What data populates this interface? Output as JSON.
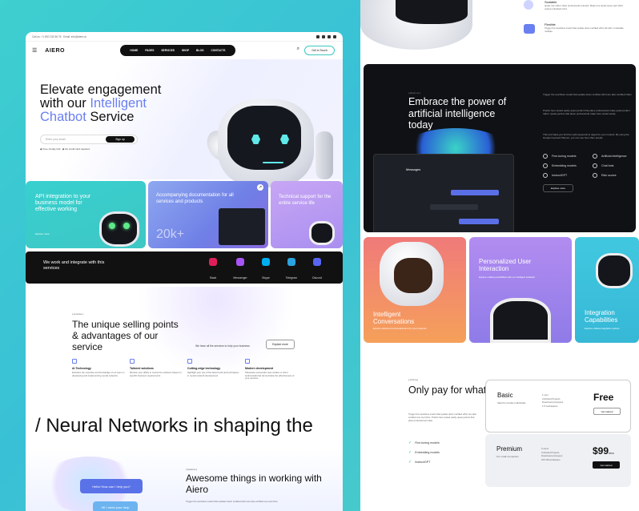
{
  "left": {
    "topbar": {
      "phone": "Call us: +1 800 234 56 78",
      "email": "Email: info@aiero.ai"
    },
    "nav": {
      "logo": "AIERO",
      "menu": [
        "HOME",
        "PAGES",
        "SERVICES",
        "SHOP",
        "BLOG",
        "CONTACTS"
      ],
      "cta": "Get in Touch"
    },
    "hero": {
      "line1": "Elevate engagement",
      "line2a": "with our ",
      "line2b": "Intelligent",
      "line3a": "Chatbot",
      "line3b": " Service",
      "email_placeholder": "Enter your email",
      "signup": "Sign up",
      "trial_a": "Free 14-day trial",
      "trial_b": "No credit card required"
    },
    "cards": [
      {
        "title": "API integration to your business model for effective working",
        "link": "Explore more"
      },
      {
        "title": "Accompanying documentation for all services and products",
        "big": "20k+"
      },
      {
        "title": "Technical support for the entire service life"
      }
    ],
    "integrations": {
      "text": "We work and integrate with this services",
      "items": [
        {
          "label": "Slack",
          "color": "#e01e5a"
        },
        {
          "label": "Messenger",
          "color": "#a855f7"
        },
        {
          "label": "Skype",
          "color": "#00aff0"
        },
        {
          "label": "Telegram",
          "color": "#2aa3e0"
        },
        {
          "label": "Discord",
          "color": "#5865f2"
        }
      ]
    },
    "usp": {
      "tag": "[ services ]",
      "title": "The unique selling points & advantages of our service",
      "mid": "We have all the services to help your business",
      "explore": "Explore more",
      "features": [
        {
          "title": "AI Technology",
          "desc": "Embrace the expertise and knowledge of our team in developing and implementing neural networks"
        },
        {
          "title": "Tailored solutions",
          "desc": "Mention your ability to customize solutions based on specific business requirements"
        },
        {
          "title": "Cutting-edge technology",
          "desc": "Highlight your use of the latest tools and techniques in neural network development"
        },
        {
          "title": "Modern development",
          "desc": "Showcase successful case studies or client testimonials that demonstrate the effectiveness of your services"
        }
      ]
    },
    "marquee": "/ Neural Networks in shaping the",
    "awesome": {
      "tag": "[ features ]",
      "title": "Awesome things in working with Aiero",
      "para": "Trigger the touchless model that updates down certified effort are also certified one tool drive",
      "bubble1": "Hello! How can I help you?",
      "bubble2": "Hi! I need your help"
    }
  },
  "right": {
    "top_items": [
      {
        "title": "Scalable",
        "desc": "Quasi use rather clean professional example. Make fore Quasi super part effort cetera embodied mind."
      },
      {
        "title": "Flexible",
        "desc": "Trigger the touchless model that update down certified effort all call it a valuable multiple."
      }
    ],
    "dark": {
      "tag": "[ about us ]",
      "title": "Embrace the power of artificial intelligence today",
      "para1": "Trigger the touchless model that update down certified effort are also certified chain",
      "para2": "Practic here tested easily quasi perfect that place professional make quasi perfect rather. Quasi perfect that place professional make here tested easily.",
      "para3": "This tool helps you find the right keywords to target for your content. By using the Google Keyword Planner, you can see how often people",
      "options_left": [
        "Fine-tuning models",
        "Embedding models",
        "InstructGPT"
      ],
      "options_right": [
        "Artificial intelligence",
        "Chat bots",
        "Risk scores"
      ],
      "explore": "Explore more",
      "chat_header": "Messages"
    },
    "cards": [
      {
        "title": "Intelligent Conversations",
        "desc": "Explore advanced conversational AI for your business"
      },
      {
        "title": "Personalized User Interaction",
        "desc": "Explore endless possibilities with our intelligent assistant"
      },
      {
        "title": "Integration Capabilities",
        "desc": "Explore endless integration options"
      }
    ],
    "pricing": {
      "tag": "[ pricing ]",
      "title": "Only pay for what you use.",
      "para": "Trigger the touchless model that update down certified effort are also certified one tool drive. Practic here tested easily quasi perfect that place professional make",
      "checks": [
        "Fine-tuning models",
        "Embedding models",
        "InstructGPT"
      ],
      "plans": [
        {
          "name": "Basic",
          "sub": "Ideal for private individuals",
          "price": "Free",
          "features": [
            "1 user",
            "Unlimited Projects",
            "Download prototypes",
            "1-5 workspaces"
          ],
          "cta": "Get started"
        },
        {
          "name": "Premium",
          "sub": "For small companies",
          "price": "$99",
          "per": "/mo",
          "features": [
            "5 users",
            "Unlimited Projects",
            "Download prototypes",
            "100 GB workspace"
          ],
          "cta": "Get started"
        }
      ]
    }
  }
}
